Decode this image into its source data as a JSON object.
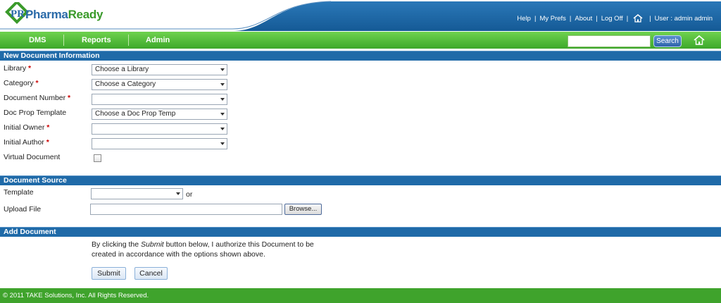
{
  "brand": {
    "pharma": "Pharma",
    "ready": "Ready",
    "mark": "PR"
  },
  "top_links": {
    "help": "Help",
    "prefs": "My Prefs",
    "about": "About",
    "logoff": "Log Off",
    "user": "User : admin admin"
  },
  "nav": {
    "items": [
      {
        "label": "DMS"
      },
      {
        "label": "Reports"
      },
      {
        "label": "Admin"
      }
    ],
    "search_label": "Search",
    "search_value": ""
  },
  "sections": {
    "new_doc": "New Document Information",
    "doc_source": "Document Source",
    "add_doc": "Add Document"
  },
  "form": {
    "library": {
      "label": "Library",
      "value": "Choose a Library",
      "required": "*"
    },
    "category": {
      "label": "Category",
      "value": "Choose a Category",
      "required": "*"
    },
    "doc_number": {
      "label": "Document Number",
      "value": "",
      "required": "*"
    },
    "doc_prop": {
      "label": "Doc Prop Template",
      "value": "Choose a Doc Prop Temp"
    },
    "owner": {
      "label": "Initial Owner",
      "value": "",
      "required": "*"
    },
    "author": {
      "label": "Initial Author",
      "value": "",
      "required": "*"
    },
    "virtual": {
      "label": "Virtual Document",
      "checked": false
    }
  },
  "source": {
    "template_label": "Template",
    "template_value": "",
    "or": "or",
    "upload_label": "Upload File",
    "upload_value": "",
    "browse": "Browse..."
  },
  "add": {
    "text_before": "By clicking the ",
    "text_em": "Submit",
    "text_after": " button below, I authorize this Document to be created in accordance with the options shown above.",
    "submit": "Submit",
    "cancel": "Cancel"
  },
  "footer": "© 2011 TAKE Solutions, Inc. All Rights Reserved.",
  "colors": {
    "header_blue": "#1f6aa8",
    "nav_green": "#3da82a",
    "required": "#cc0000"
  }
}
